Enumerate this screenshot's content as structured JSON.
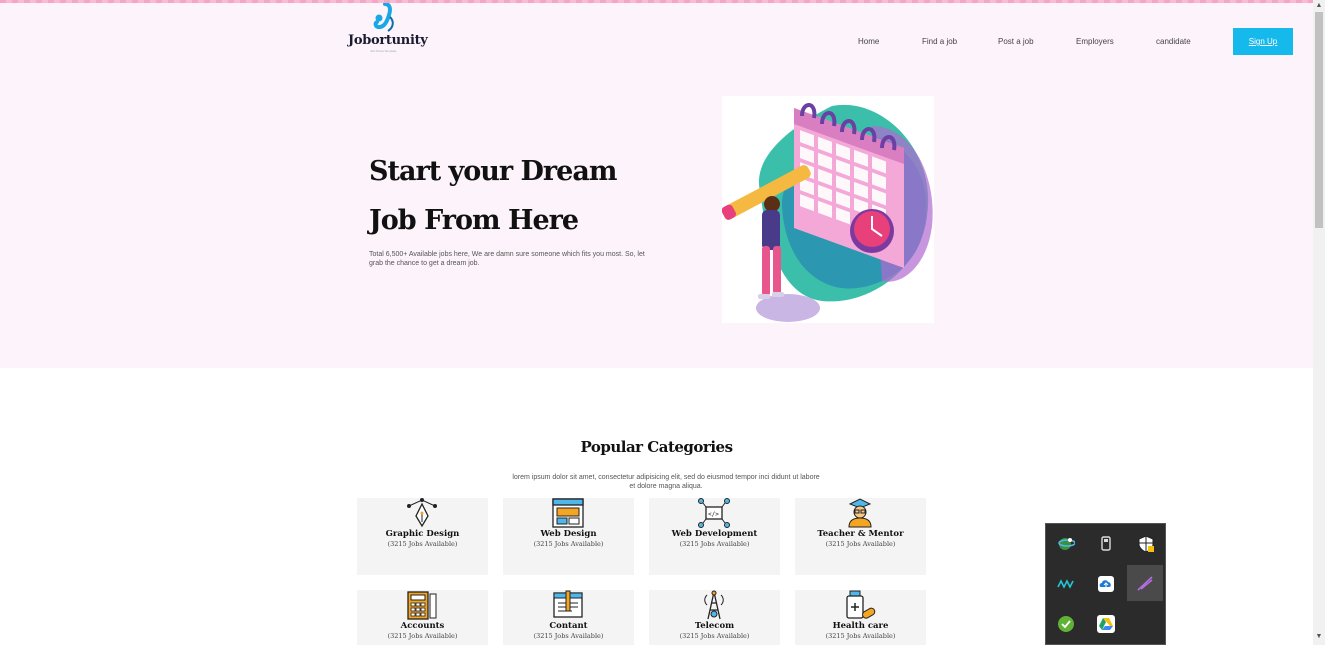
{
  "brand": {
    "name": "Jobortunity",
    "tagline": "Job Portal Template"
  },
  "nav": {
    "items": [
      "Home",
      "Find a job",
      "Post a job",
      "Employers",
      "candidate"
    ],
    "signup_label": "Sign Up"
  },
  "hero": {
    "title_line1": "Start your Dream",
    "title_line2": "Job From Here",
    "description": "Total 6,500+ Available jobs here, We are damn sure someone which fits you most. So, let grab the chance to get a dream job."
  },
  "categories": {
    "title": "Popular Categories",
    "description": "lorem ipsum dolor sit amet, consectetur adipisicing elit, sed do eiusmod tempor inci didunt ut labore et dolore magna aliqua.",
    "items": [
      {
        "name": "Graphic Design",
        "count": "(3215 Jobs Available)",
        "icon": "pen-tool-icon"
      },
      {
        "name": "Web Design",
        "count": "(3215 Jobs Available)",
        "icon": "browser-window-icon"
      },
      {
        "name": "Web Development",
        "count": "(3215 Jobs Available)",
        "icon": "code-network-icon"
      },
      {
        "name": "Teacher & Mentor",
        "count": "(3215 Jobs Available)",
        "icon": "graduate-icon"
      },
      {
        "name": "Accounts",
        "count": "(3215 Jobs Available)",
        "icon": "calculator-icon"
      },
      {
        "name": "Contant",
        "count": "(3215 Jobs Available)",
        "icon": "content-writing-icon"
      },
      {
        "name": "Telecom",
        "count": "(3215 Jobs Available)",
        "icon": "telecom-tower-icon"
      },
      {
        "name": "Health care",
        "count": "(3215 Jobs Available)",
        "icon": "medicine-icon"
      }
    ]
  },
  "tray": {
    "icons": [
      "network-globe-icon",
      "usb-drive-icon",
      "security-shield-icon",
      "audio-wave-icon",
      "cloud-upload-icon",
      "feather-pen-icon",
      "antivirus-check-icon",
      "google-drive-icon"
    ]
  },
  "colors": {
    "accent": "#16b9ec",
    "hero_bg": "#fdf4fb",
    "card_bg": "#f4f4f4"
  }
}
